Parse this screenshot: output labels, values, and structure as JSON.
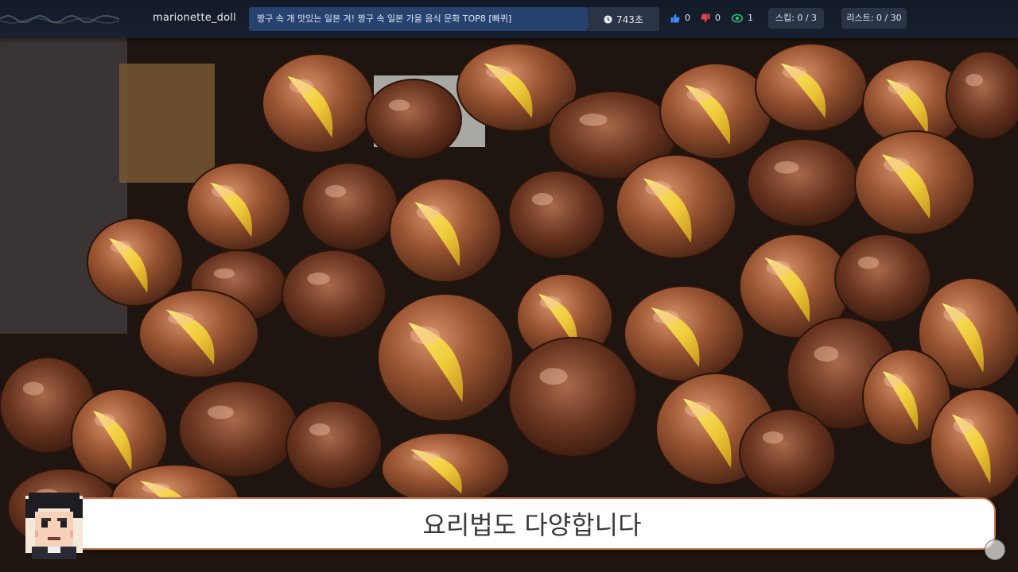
{
  "stream": {
    "streamer_name": "marionette_doll",
    "video_title": "짱구 속 개 맛있는 일본 겨! 짱구 속 일본 가을 음식 문화 TOP8 [빠퀴]",
    "timer": "743초",
    "likes": "0",
    "dislikes": "0",
    "views": "1",
    "skip_label": "스킵: 0 / 3",
    "list_label": "리스트: 0 / 30"
  },
  "subtitle": {
    "text": "요리법도 다양합니다"
  },
  "icons": {
    "timer": "clock-icon",
    "likes": "thumbs-up-icon",
    "dislikes": "thumbs-down-icon",
    "views": "eye-icon",
    "avatar": "pixel-avatar",
    "corner": "channel-logo"
  },
  "colors": {
    "topbar": "#121a28",
    "title_box": "#27426e",
    "like": "#3d8af7",
    "dislike": "#e0434b",
    "views": "#2fbf71",
    "subtitle_border": "#c9754f"
  }
}
